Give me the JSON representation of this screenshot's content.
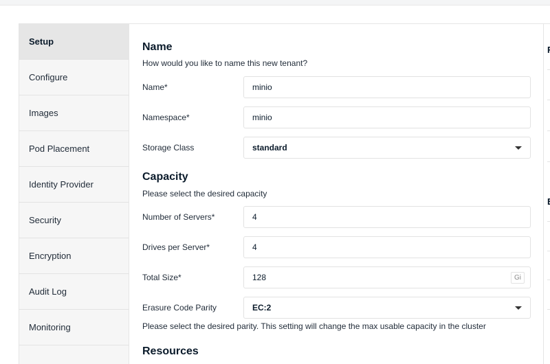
{
  "sidebar": {
    "items": [
      {
        "label": "Setup",
        "active": true
      },
      {
        "label": "Configure",
        "active": false
      },
      {
        "label": "Images",
        "active": false
      },
      {
        "label": "Pod Placement",
        "active": false
      },
      {
        "label": "Identity Provider",
        "active": false
      },
      {
        "label": "Security",
        "active": false
      },
      {
        "label": "Encryption",
        "active": false
      },
      {
        "label": "Audit Log",
        "active": false
      },
      {
        "label": "Monitoring",
        "active": false
      }
    ]
  },
  "name_section": {
    "title": "Name",
    "description": "How would you like to name this new tenant?",
    "name_label": "Name*",
    "name_value": "minio",
    "namespace_label": "Namespace*",
    "namespace_value": "minio",
    "storage_class_label": "Storage Class",
    "storage_class_value": "standard"
  },
  "capacity_section": {
    "title": "Capacity",
    "description": "Please select the desired capacity",
    "servers_label": "Number of Servers*",
    "servers_value": "4",
    "drives_label": "Drives per Server*",
    "drives_value": "4",
    "total_size_label": "Total Size*",
    "total_size_value": "128",
    "total_size_unit": "Gi",
    "parity_label": "Erasure Code Parity",
    "parity_value": "EC:2",
    "parity_help": "Please select the desired parity. This setting will change the max usable capacity in the cluster"
  },
  "resources_section": {
    "title": "Resources"
  },
  "right_panel": {
    "letters": [
      "F",
      "E"
    ]
  },
  "icons": {
    "dropdown": "caret-down-icon"
  }
}
